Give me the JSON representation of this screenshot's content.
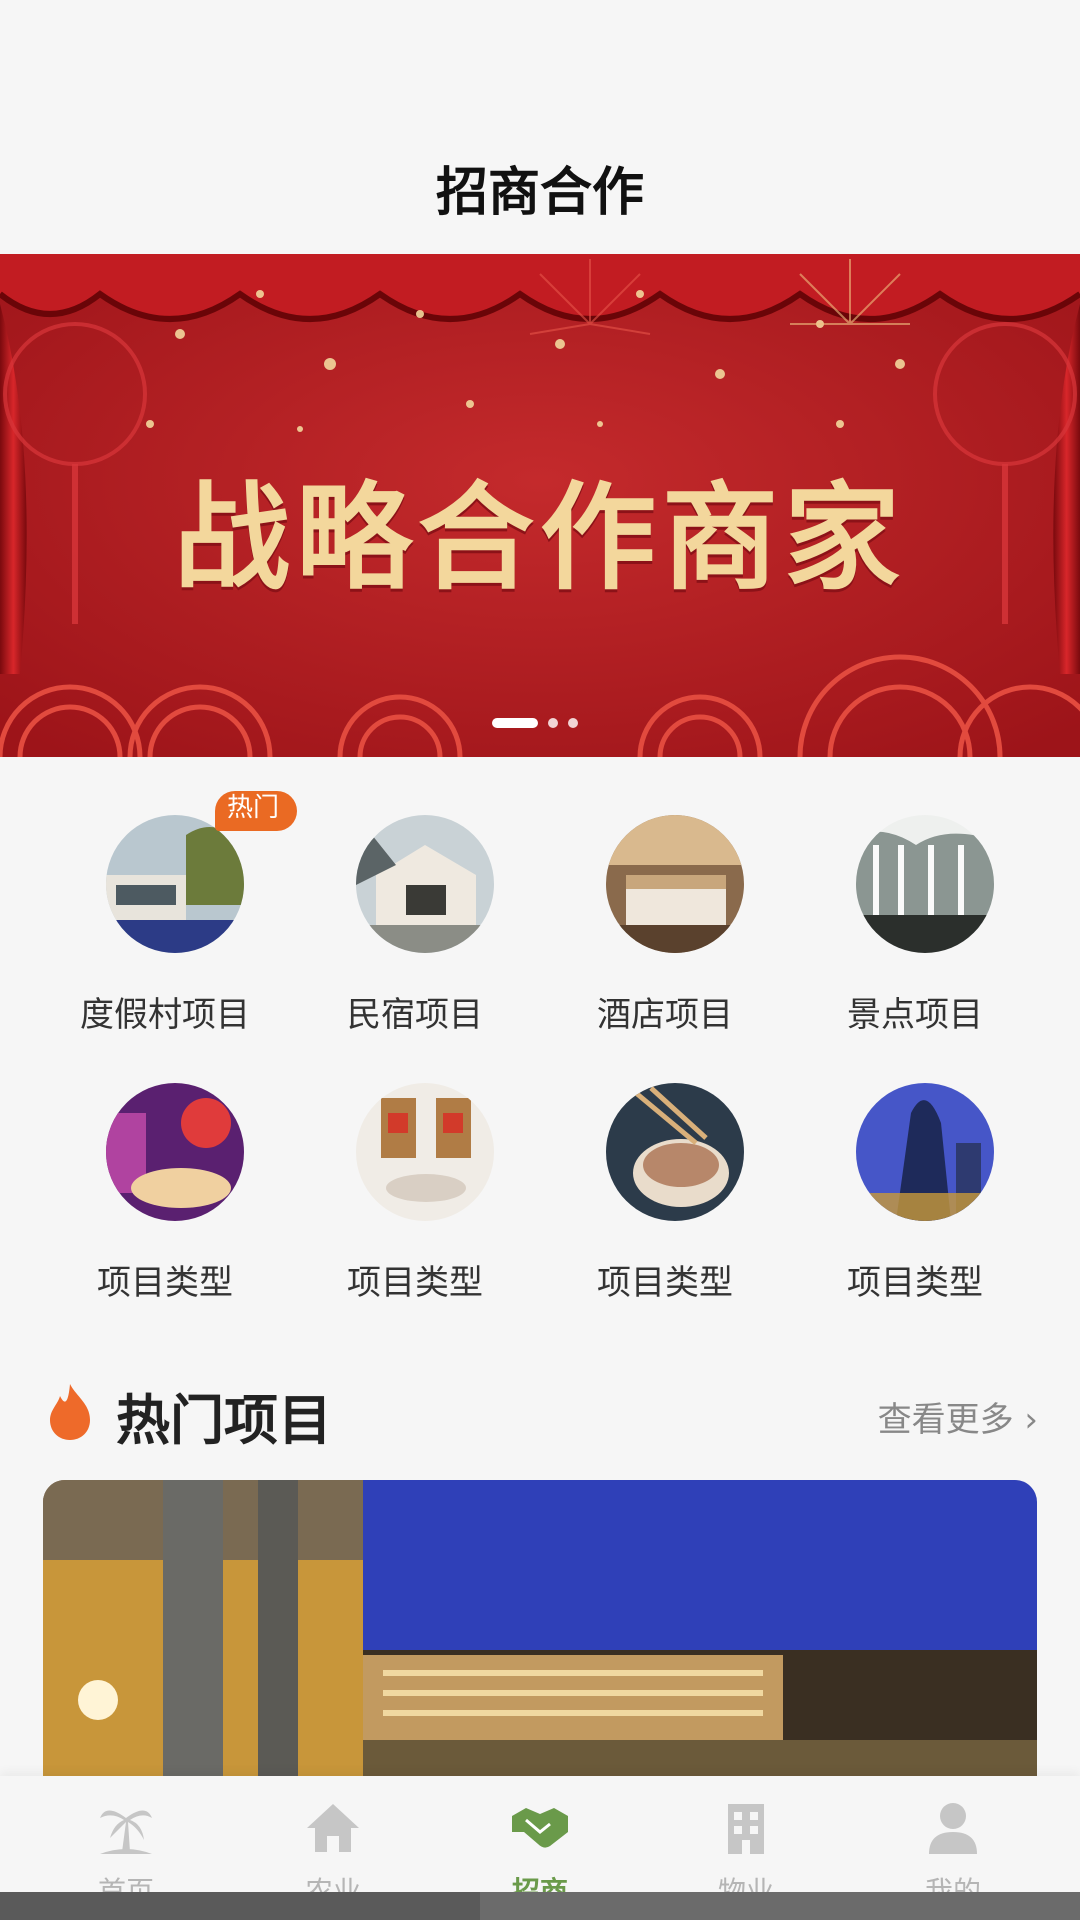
{
  "header": {
    "title": "招商合作"
  },
  "banner": {
    "text": "战略合作商家",
    "dots": 3,
    "active_dot": 0
  },
  "categories": [
    {
      "label": "度假村项目",
      "icon": "resort-photo",
      "badge": "热门"
    },
    {
      "label": "民宿项目",
      "icon": "homestay-photo"
    },
    {
      "label": "酒店项目",
      "icon": "hotel-room-photo"
    },
    {
      "label": "景点项目",
      "icon": "waterfall-photo"
    },
    {
      "label": "项目类型",
      "icon": "party-room-photo"
    },
    {
      "label": "项目类型",
      "icon": "gift-box-photo"
    },
    {
      "label": "项目类型",
      "icon": "noodle-bowl-photo"
    },
    {
      "label": "项目类型",
      "icon": "skyscraper-photo"
    }
  ],
  "hot_section": {
    "title": "热门项目",
    "more": "查看更多"
  },
  "tabbar": {
    "items": [
      {
        "label": "首页",
        "icon": "palm-tree-icon"
      },
      {
        "label": "农业",
        "icon": "home-icon"
      },
      {
        "label": "招商",
        "icon": "handshake-icon",
        "active": true
      },
      {
        "label": "物业",
        "icon": "building-icon"
      },
      {
        "label": "我的",
        "icon": "user-icon"
      }
    ]
  },
  "colors": {
    "accent": "#6a9a4a",
    "badge": "#ea6a23",
    "banner_bg": "#b11a21",
    "banner_text": "#f3d79c"
  }
}
